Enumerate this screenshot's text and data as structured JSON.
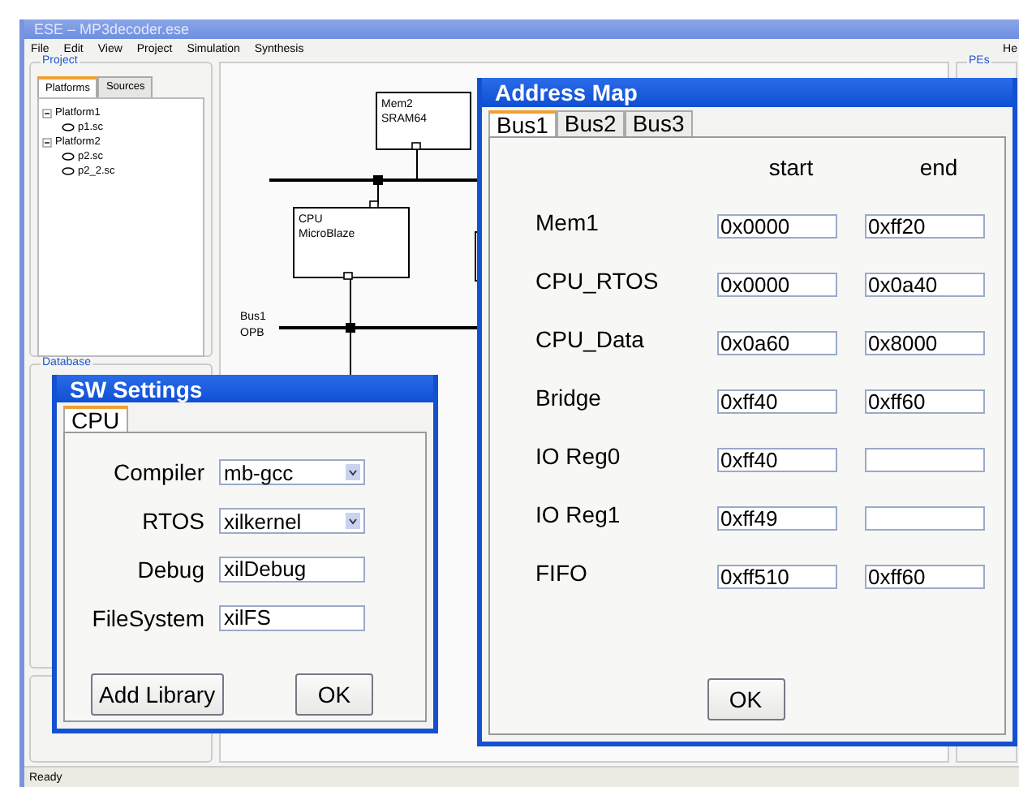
{
  "window": {
    "title": "ESE – MP3decoder.ese"
  },
  "menu": [
    "File",
    "Edit",
    "View",
    "Project",
    "Simulation",
    "Synthesis",
    "He"
  ],
  "project_panel": {
    "title": "Project",
    "tabs": [
      {
        "label": "Platforms",
        "selected": true
      },
      {
        "label": "Sources",
        "selected": false
      }
    ],
    "tree": [
      {
        "label": "Platform1",
        "expanded": true,
        "children": [
          {
            "label": "p1.sc"
          }
        ]
      },
      {
        "label": "Platform2",
        "expanded": true,
        "children": [
          {
            "label": "p2.sc"
          },
          {
            "label": "p2_2.sc"
          }
        ]
      }
    ]
  },
  "database_panel": {
    "title": "Database"
  },
  "pes_panel": {
    "title": "PEs"
  },
  "diagram": {
    "components": [
      {
        "lines": [
          "Mem2",
          "SRAM64"
        ]
      },
      {
        "lines": [
          "CPU",
          "MicroBlaze"
        ]
      }
    ],
    "buses": [
      {
        "lines": [
          "Bus1",
          "OPB"
        ]
      }
    ]
  },
  "status_bar": "Ready",
  "sw_settings": {
    "title": "SW Settings",
    "tabs": [
      {
        "label": "CPU",
        "selected": true
      }
    ],
    "fields": [
      {
        "label": "Compiler",
        "kind": "select",
        "value": "mb-gcc"
      },
      {
        "label": "RTOS",
        "kind": "select",
        "value": "xilkernel"
      },
      {
        "label": "Debug",
        "kind": "text",
        "value": "xilDebug"
      },
      {
        "label": "FileSystem",
        "kind": "text",
        "value": "xilFS"
      }
    ],
    "buttons": [
      "Add Library",
      "OK"
    ]
  },
  "address_map": {
    "title": "Address Map",
    "tabs": [
      {
        "label": "Bus1",
        "selected": true
      },
      {
        "label": "Bus2",
        "selected": false
      },
      {
        "label": "Bus3",
        "selected": false
      }
    ],
    "columns": [
      "start",
      "end"
    ],
    "rows": [
      {
        "name": "Mem1",
        "start": "0x0000",
        "end": "0xff20"
      },
      {
        "name": "CPU_RTOS",
        "start": "0x0000",
        "end": "0x0a40"
      },
      {
        "name": "CPU_Data",
        "start": "0x0a60",
        "end": "0x8000"
      },
      {
        "name": "Bridge",
        "start": "0xff40",
        "end": "0xff60"
      },
      {
        "name": "IO Reg0",
        "start": "0xff40",
        "end": ""
      },
      {
        "name": "IO Reg1",
        "start": "0xff49",
        "end": ""
      },
      {
        "name": "FIFO",
        "start": "0xff510",
        "end": "0xff60"
      }
    ],
    "button": "OK"
  }
}
